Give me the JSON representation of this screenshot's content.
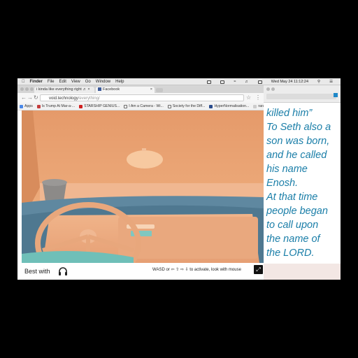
{
  "menubar": {
    "finder": "Finder",
    "items": [
      "File",
      "Edit",
      "View",
      "Go",
      "Window",
      "Help"
    ],
    "datetime": "Wed May 24  11:12:24"
  },
  "browser": {
    "tabs": [
      {
        "label": "i kinda like everything right"
      },
      {
        "label": "Facebook"
      }
    ],
    "url_host": "void.technology",
    "url_path": "/everything/",
    "bookmarks": [
      {
        "label": "Apps",
        "color": "#4a88e8"
      },
      {
        "label": "Is Trump At Mar-a-...",
        "color": "#c43c3c"
      },
      {
        "label": "STARSHIP GENIUS...",
        "color": "#d02020"
      },
      {
        "label": "I Am a Camera - Wi...",
        "color": "#666666"
      },
      {
        "label": "Society for the Diff...",
        "color": "#666666"
      },
      {
        "label": "HyperNormalisation...",
        "color": "#2a4c8c"
      },
      {
        "label": "rarae.pdf",
        "color": "#cccccc"
      }
    ],
    "bottom": {
      "best_with": "Best with",
      "hint": "WASD or ⇦ ⇧ ⇨ ⇩ to activate, look with mouse"
    }
  },
  "right_window": {
    "lines": [
      "killed him”",
      "To Seth also a",
      "son was born,",
      "and he called",
      "his name",
      "Enosh.",
      "At that time",
      "people began",
      "to call upon",
      "the name of",
      "the LORD."
    ],
    "text_color": "#1a7ea8"
  }
}
